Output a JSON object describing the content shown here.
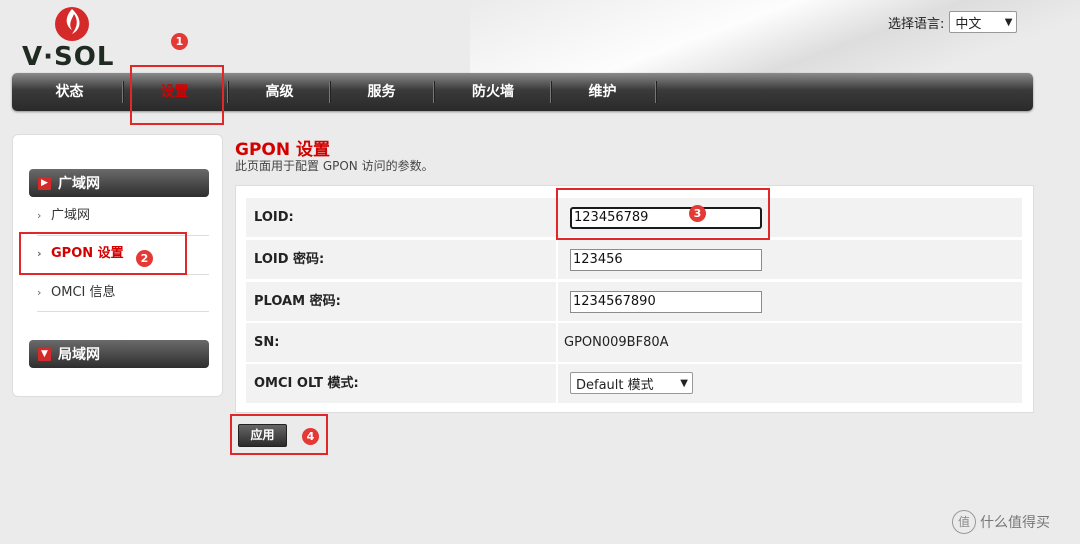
{
  "brand": {
    "logo_text": "V·SOL"
  },
  "language": {
    "label": "选择语言:",
    "selected": "中文"
  },
  "top_nav": {
    "items": [
      {
        "label": "状态",
        "active": false
      },
      {
        "label": "设置",
        "active": true
      },
      {
        "label": "高级",
        "active": false
      },
      {
        "label": "服务",
        "active": false
      },
      {
        "label": "防火墙",
        "active": false
      },
      {
        "label": "维护",
        "active": false
      }
    ]
  },
  "sidebar": {
    "groups": [
      {
        "label": "广域网",
        "icon": "expand-arrow-icon"
      },
      {
        "label": "局域网",
        "icon": "collapse-arrow-icon"
      }
    ],
    "items": [
      {
        "label": "广域网",
        "active": false
      },
      {
        "label": "GPON 设置",
        "active": true
      },
      {
        "label": "OMCI 信息",
        "active": false
      }
    ]
  },
  "page": {
    "title": "GPON 设置",
    "description": "此页面用于配置 GPON 访问的参数。"
  },
  "form": {
    "loid": {
      "label": "LOID:",
      "value": "123456789"
    },
    "loid_password": {
      "label": "LOID 密码:",
      "value": "123456"
    },
    "ploam_password": {
      "label": "PLOAM 密码:",
      "value": "1234567890"
    },
    "sn": {
      "label": "SN:",
      "value": "GPON009BF80A"
    },
    "omci_olt_mode": {
      "label": "OMCI OLT 模式:",
      "value": "Default 模式"
    }
  },
  "apply_label": "应用",
  "annotations": {
    "badge1": "1",
    "badge2": "2",
    "badge3": "3",
    "badge4": "4"
  },
  "watermark": {
    "icon_text": "值",
    "text": "什么值得买"
  },
  "colors": {
    "accent_red": "#d30000",
    "annotation_red": "#e0282b",
    "nav_dark": "#2a2a2a"
  }
}
